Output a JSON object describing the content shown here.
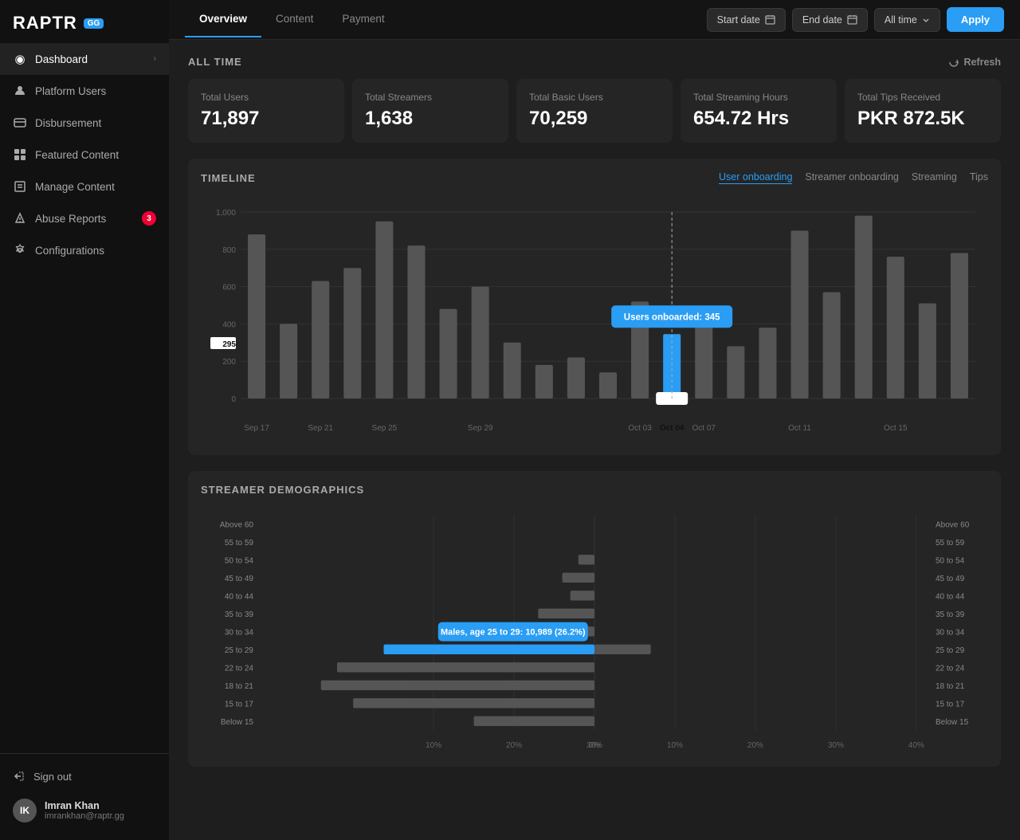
{
  "logo": {
    "text": "RAPTR",
    "badge": "GG"
  },
  "sidebar": {
    "items": [
      {
        "id": "dashboard",
        "label": "Dashboard",
        "icon": "◉",
        "active": true,
        "arrow": true
      },
      {
        "id": "platform-users",
        "label": "Platform Users",
        "icon": "👤",
        "active": false
      },
      {
        "id": "disbursement",
        "label": "Disbursement",
        "icon": "🖥",
        "active": false
      },
      {
        "id": "featured-content",
        "label": "Featured Content",
        "icon": "⊞",
        "active": false
      },
      {
        "id": "manage-content",
        "label": "Manage Content",
        "icon": "⊡",
        "active": false
      },
      {
        "id": "abuse-reports",
        "label": "Abuse Reports",
        "icon": "⚑",
        "active": false,
        "badge": "3"
      },
      {
        "id": "configurations",
        "label": "Configurations",
        "icon": "⚙",
        "active": false
      }
    ],
    "sign_out_label": "Sign out",
    "user": {
      "name": "Imran Khan",
      "email": "imrankhan@raptr.gg",
      "initials": "IK"
    }
  },
  "top_nav": {
    "tabs": [
      {
        "id": "overview",
        "label": "Overview",
        "active": true
      },
      {
        "id": "content",
        "label": "Content",
        "active": false
      },
      {
        "id": "payment",
        "label": "Payment",
        "active": false
      }
    ],
    "start_date_label": "Start date",
    "end_date_label": "End date",
    "period_label": "All time",
    "apply_label": "Apply"
  },
  "all_time_section": {
    "title": "ALL TIME",
    "refresh_label": "Refresh",
    "stats": [
      {
        "label": "Total Users",
        "value": "71,897"
      },
      {
        "label": "Total Streamers",
        "value": "1,638"
      },
      {
        "label": "Total Basic Users",
        "value": "70,259"
      },
      {
        "label": "Total Streaming Hours",
        "value": "654.72 Hrs"
      },
      {
        "label": "Total Tips Received",
        "value": "PKR 872.5K"
      }
    ]
  },
  "timeline": {
    "title": "TIMELINE",
    "tabs": [
      {
        "label": "User onboarding",
        "active": true
      },
      {
        "label": "Streamer onboarding",
        "active": false
      },
      {
        "label": "Streaming",
        "active": false
      },
      {
        "label": "Tips",
        "active": false
      }
    ],
    "tooltip": {
      "label": "Users onboarded: 345",
      "date": "Oct 04"
    },
    "y_labels": [
      "0",
      "200",
      "400",
      "600",
      "800",
      "1,000"
    ],
    "x_labels": [
      "Sep 17",
      "Sep 21",
      "Sep 25",
      "Sep 29",
      "Oct 03",
      "Oct 04",
      "Oct 07",
      "Oct 11",
      "Oct 15"
    ],
    "highlighted_bar_label": "295",
    "bars": [
      {
        "label": "Sep 17",
        "height": 0.88,
        "highlighted": false
      },
      {
        "label": "",
        "height": 0.4,
        "highlighted": false
      },
      {
        "label": "Sep 21",
        "height": 0.63,
        "highlighted": false
      },
      {
        "label": "",
        "height": 0.7,
        "highlighted": false
      },
      {
        "label": "Sep 25",
        "height": 0.95,
        "highlighted": false
      },
      {
        "label": "",
        "height": 0.82,
        "highlighted": false
      },
      {
        "label": "",
        "height": 0.48,
        "highlighted": false
      },
      {
        "label": "Sep 29",
        "height": 0.6,
        "highlighted": false
      },
      {
        "label": "",
        "height": 0.3,
        "highlighted": false
      },
      {
        "label": "",
        "height": 0.18,
        "highlighted": false
      },
      {
        "label": "",
        "height": 0.22,
        "highlighted": false
      },
      {
        "label": "",
        "height": 0.14,
        "highlighted": false
      },
      {
        "label": "Oct 03",
        "height": 0.52,
        "highlighted": false
      },
      {
        "label": "Oct 04",
        "height": 0.345,
        "highlighted": true
      },
      {
        "label": "Oct 07",
        "height": 0.44,
        "highlighted": false
      },
      {
        "label": "",
        "height": 0.28,
        "highlighted": false
      },
      {
        "label": "",
        "height": 0.38,
        "highlighted": false
      },
      {
        "label": "Oct 11",
        "height": 0.9,
        "highlighted": false
      },
      {
        "label": "",
        "height": 0.57,
        "highlighted": false
      },
      {
        "label": "",
        "height": 0.98,
        "highlighted": false
      },
      {
        "label": "Oct 15",
        "height": 0.76,
        "highlighted": false
      },
      {
        "label": "",
        "height": 0.51,
        "highlighted": false
      },
      {
        "label": "",
        "height": 0.78,
        "highlighted": false
      }
    ]
  },
  "demographics": {
    "title": "STREAMER DEMOGRAPHICS",
    "tooltip": "Males, age 25 to 29: 10,989 (26.2%)",
    "age_groups": [
      {
        "label": "Above 60",
        "male": 0,
        "female": 0
      },
      {
        "label": "55 to 59",
        "male": 0,
        "female": 0
      },
      {
        "label": "50 to 54",
        "male": 0.02,
        "female": 0
      },
      {
        "label": "45 to 49",
        "male": 0.04,
        "female": 0
      },
      {
        "label": "40 to 44",
        "male": 0.03,
        "female": 0
      },
      {
        "label": "35 to 39",
        "male": 0.07,
        "female": 0
      },
      {
        "label": "30 to 34",
        "male": 0.1,
        "female": 0
      },
      {
        "label": "25 to 29",
        "male": 0.262,
        "female": 0.07,
        "highlighted": true
      },
      {
        "label": "22 to 24",
        "male": 0.32,
        "female": 0
      },
      {
        "label": "18 to 21",
        "male": 0.34,
        "female": 0
      },
      {
        "label": "15 to 17",
        "male": 0.3,
        "female": 0
      },
      {
        "label": "Below 15",
        "male": 0.15,
        "female": 0
      }
    ],
    "x_labels_left": [
      "30%",
      "20%",
      "10%",
      "0%"
    ],
    "x_labels_right": [
      "10%",
      "20%",
      "30%",
      "40%"
    ]
  }
}
